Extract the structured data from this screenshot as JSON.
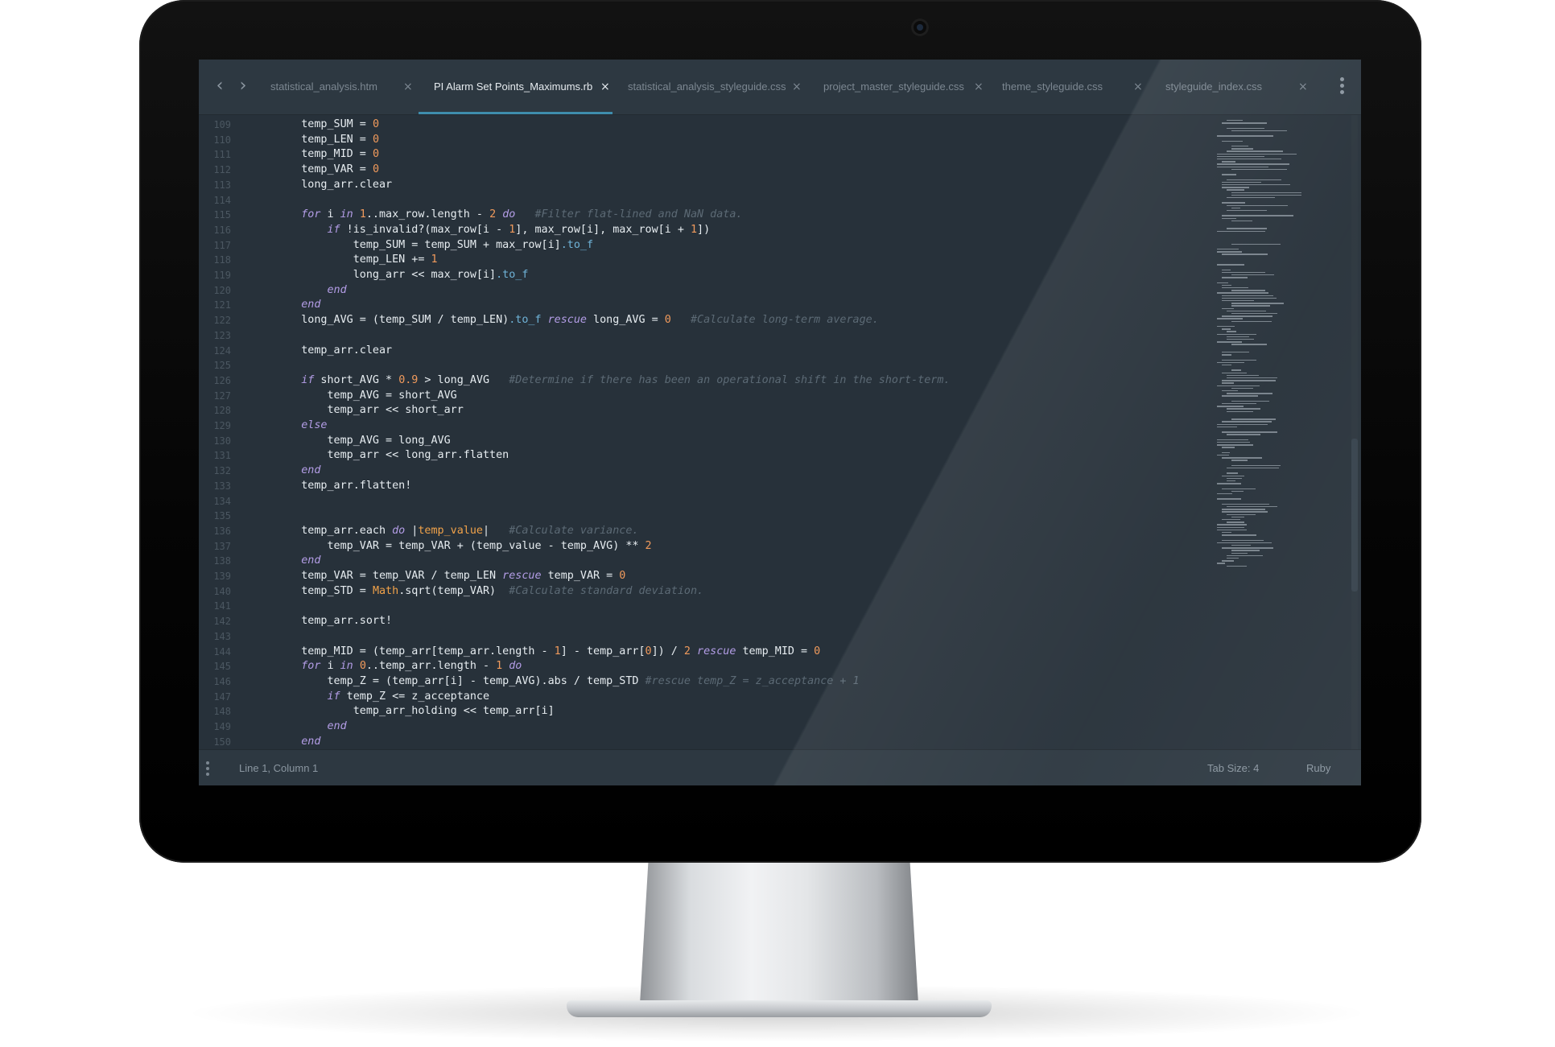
{
  "tabs": [
    {
      "label": "statistical_analysis.htm",
      "active": false
    },
    {
      "label": "PI Alarm Set Points_Maximums.rb",
      "active": true
    },
    {
      "label": "statistical_analysis_styleguide.css",
      "active": false
    },
    {
      "label": "project_master_styleguide.css",
      "active": false
    },
    {
      "label": "theme_styleguide.css",
      "active": false
    },
    {
      "label": "styleguide_index.css",
      "active": false
    }
  ],
  "tab_close_glyph": "×",
  "nav": {
    "back_glyph": "‹",
    "forward_glyph": "›"
  },
  "code_lines": [
    {
      "n": "109",
      "s": [
        [
          "",
          "    "
        ],
        [
          "",
          "temp_SUM = "
        ],
        [
          "n",
          "0"
        ]
      ]
    },
    {
      "n": "110",
      "s": [
        [
          "",
          "    "
        ],
        [
          "",
          "temp_LEN = "
        ],
        [
          "n",
          "0"
        ]
      ]
    },
    {
      "n": "111",
      "s": [
        [
          "",
          "    "
        ],
        [
          "",
          "temp_MID = "
        ],
        [
          "n",
          "0"
        ]
      ]
    },
    {
      "n": "112",
      "s": [
        [
          "",
          "    "
        ],
        [
          "",
          "temp_VAR = "
        ],
        [
          "n",
          "0"
        ]
      ]
    },
    {
      "n": "113",
      "s": [
        [
          "",
          "    "
        ],
        [
          "",
          "long_arr.clear"
        ]
      ]
    },
    {
      "n": "114",
      "s": []
    },
    {
      "n": "115",
      "s": [
        [
          "",
          "    "
        ],
        [
          "k",
          "for"
        ],
        [
          "",
          " i "
        ],
        [
          "k",
          "in"
        ],
        [
          "",
          " "
        ],
        [
          "n",
          "1"
        ],
        [
          "",
          "..max_row.length - "
        ],
        [
          "n",
          "2"
        ],
        [
          "",
          " "
        ],
        [
          "k",
          "do"
        ],
        [
          "",
          "   "
        ],
        [
          "c",
          "#Filter flat-lined and NaN data."
        ]
      ]
    },
    {
      "n": "116",
      "s": [
        [
          "",
          "        "
        ],
        [
          "k",
          "if"
        ],
        [
          "",
          " !is_invalid?(max_row[i - "
        ],
        [
          "n",
          "1"
        ],
        [
          "",
          "], max_row[i], max_row[i + "
        ],
        [
          "n",
          "1"
        ],
        [
          "",
          "])"
        ]
      ]
    },
    {
      "n": "117",
      "s": [
        [
          "",
          "            "
        ],
        [
          "",
          "temp_SUM = temp_SUM + max_row[i]"
        ],
        [
          "m",
          ".to_f"
        ]
      ]
    },
    {
      "n": "118",
      "s": [
        [
          "",
          "            "
        ],
        [
          "",
          "temp_LEN += "
        ],
        [
          "n",
          "1"
        ]
      ]
    },
    {
      "n": "119",
      "s": [
        [
          "",
          "            "
        ],
        [
          "",
          "long_arr << max_row[i]"
        ],
        [
          "m",
          ".to_f"
        ]
      ]
    },
    {
      "n": "120",
      "s": [
        [
          "",
          "        "
        ],
        [
          "k",
          "end"
        ]
      ]
    },
    {
      "n": "121",
      "s": [
        [
          "",
          "    "
        ],
        [
          "k",
          "end"
        ]
      ]
    },
    {
      "n": "122",
      "s": [
        [
          "",
          "    "
        ],
        [
          "",
          "long_AVG = (temp_SUM / temp_LEN)"
        ],
        [
          "m",
          ".to_f"
        ],
        [
          "",
          " "
        ],
        [
          "k",
          "rescue"
        ],
        [
          "",
          " long_AVG = "
        ],
        [
          "n",
          "0"
        ],
        [
          "",
          "   "
        ],
        [
          "c",
          "#Calculate long-term average."
        ]
      ]
    },
    {
      "n": "123",
      "s": []
    },
    {
      "n": "124",
      "s": [
        [
          "",
          "    "
        ],
        [
          "",
          "temp_arr.clear"
        ]
      ]
    },
    {
      "n": "125",
      "s": []
    },
    {
      "n": "126",
      "s": [
        [
          "",
          "    "
        ],
        [
          "k",
          "if"
        ],
        [
          "",
          " short_AVG * "
        ],
        [
          "n",
          "0.9"
        ],
        [
          "",
          " > long_AVG   "
        ],
        [
          "c",
          "#Determine if there has been an operational shift in the short-term."
        ]
      ]
    },
    {
      "n": "127",
      "s": [
        [
          "",
          "        "
        ],
        [
          "",
          "temp_AVG = short_AVG"
        ]
      ]
    },
    {
      "n": "128",
      "s": [
        [
          "",
          "        "
        ],
        [
          "",
          "temp_arr << short_arr"
        ]
      ]
    },
    {
      "n": "129",
      "s": [
        [
          "",
          "    "
        ],
        [
          "k",
          "else"
        ]
      ]
    },
    {
      "n": "130",
      "s": [
        [
          "",
          "        "
        ],
        [
          "",
          "temp_AVG = long_AVG"
        ]
      ]
    },
    {
      "n": "131",
      "s": [
        [
          "",
          "        "
        ],
        [
          "",
          "temp_arr << long_arr.flatten"
        ]
      ]
    },
    {
      "n": "132",
      "s": [
        [
          "",
          "    "
        ],
        [
          "k",
          "end"
        ]
      ]
    },
    {
      "n": "133",
      "s": [
        [
          "",
          "    "
        ],
        [
          "",
          "temp_arr.flatten!"
        ]
      ]
    },
    {
      "n": "134",
      "s": []
    },
    {
      "n": "135",
      "s": []
    },
    {
      "n": "136",
      "s": [
        [
          "",
          "    "
        ],
        [
          "",
          "temp_arr.each "
        ],
        [
          "k",
          "do"
        ],
        [
          "",
          " |"
        ],
        [
          "v",
          "temp_value"
        ],
        [
          "",
          "|   "
        ],
        [
          "c",
          "#Calculate variance."
        ]
      ]
    },
    {
      "n": "137",
      "s": [
        [
          "",
          "        "
        ],
        [
          "",
          "temp_VAR = temp_VAR + (temp_value - temp_AVG) ** "
        ],
        [
          "n",
          "2"
        ]
      ]
    },
    {
      "n": "138",
      "s": [
        [
          "",
          "    "
        ],
        [
          "k",
          "end"
        ]
      ]
    },
    {
      "n": "139",
      "s": [
        [
          "",
          "    "
        ],
        [
          "",
          "temp_VAR = temp_VAR / temp_LEN "
        ],
        [
          "k",
          "rescue"
        ],
        [
          "",
          " temp_VAR = "
        ],
        [
          "n",
          "0"
        ]
      ]
    },
    {
      "n": "140",
      "s": [
        [
          "",
          "    "
        ],
        [
          "",
          "temp_STD = "
        ],
        [
          "v",
          "Math"
        ],
        [
          "",
          ".sqrt(temp_VAR)  "
        ],
        [
          "c",
          "#Calculate standard deviation."
        ]
      ]
    },
    {
      "n": "141",
      "s": []
    },
    {
      "n": "142",
      "s": [
        [
          "",
          "    "
        ],
        [
          "",
          "temp_arr.sort!"
        ]
      ]
    },
    {
      "n": "143",
      "s": []
    },
    {
      "n": "144",
      "s": [
        [
          "",
          "    "
        ],
        [
          "",
          "temp_MID = (temp_arr[temp_arr.length - "
        ],
        [
          "n",
          "1"
        ],
        [
          "",
          "] - temp_arr["
        ],
        [
          "n",
          "0"
        ],
        [
          "",
          "]) / "
        ],
        [
          "n",
          "2"
        ],
        [
          "",
          " "
        ],
        [
          "k",
          "rescue"
        ],
        [
          "",
          " temp_MID = "
        ],
        [
          "n",
          "0"
        ]
      ]
    },
    {
      "n": "145",
      "s": [
        [
          "",
          "    "
        ],
        [
          "k",
          "for"
        ],
        [
          "",
          " i "
        ],
        [
          "k",
          "in"
        ],
        [
          "",
          " "
        ],
        [
          "n",
          "0"
        ],
        [
          "",
          "..temp_arr.length - "
        ],
        [
          "n",
          "1"
        ],
        [
          "",
          " "
        ],
        [
          "k",
          "do"
        ]
      ]
    },
    {
      "n": "146",
      "s": [
        [
          "",
          "        "
        ],
        [
          "",
          "temp_Z = (temp_arr[i] - temp_AVG).abs / temp_STD "
        ],
        [
          "c",
          "#rescue temp_Z = z_acceptance + 1"
        ]
      ]
    },
    {
      "n": "147",
      "s": [
        [
          "",
          "        "
        ],
        [
          "k",
          "if"
        ],
        [
          "",
          " temp_Z <= z_acceptance"
        ]
      ]
    },
    {
      "n": "148",
      "s": [
        [
          "",
          "            "
        ],
        [
          "",
          "temp_arr_holding << temp_arr[i]"
        ]
      ]
    },
    {
      "n": "149",
      "s": [
        [
          "",
          "        "
        ],
        [
          "k",
          "end"
        ]
      ]
    },
    {
      "n": "150",
      "s": [
        [
          "",
          "    "
        ],
        [
          "k",
          "end"
        ]
      ]
    }
  ],
  "status": {
    "position": "Line 1, Column 1",
    "tab_size": "Tab Size: 4",
    "language": "Ruby"
  },
  "colors": {
    "background": "#27313a",
    "keyword": "#b39de6",
    "number": "#f09a5c",
    "method": "#6fb3d8",
    "comment": "#5c6a75",
    "accent": "#3f8dad"
  }
}
